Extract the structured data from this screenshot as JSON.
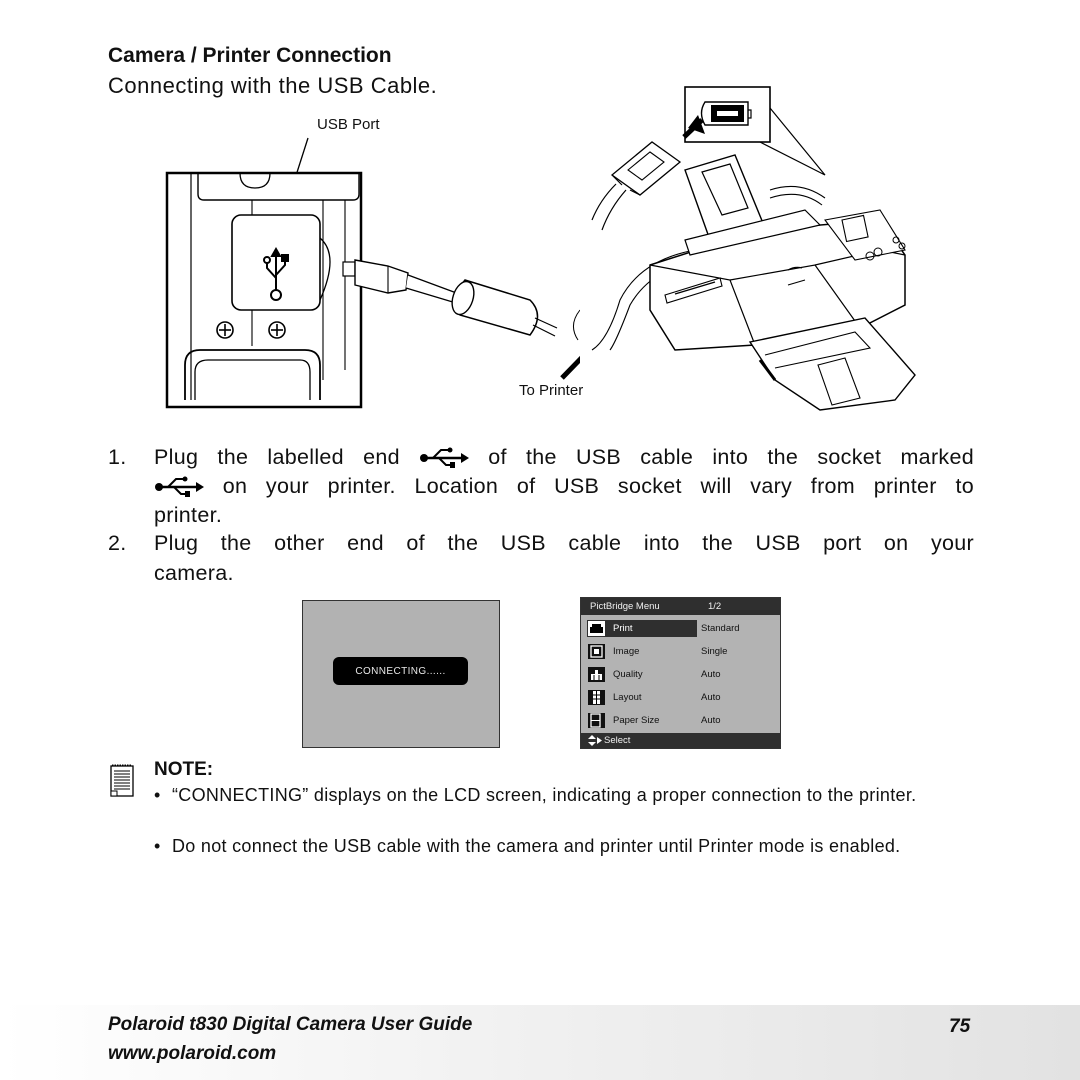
{
  "header": {
    "title": "Camera / Printer Connection",
    "subtitle": "Connecting with the USB Cable."
  },
  "illustration": {
    "label_usb_port": "USB Port",
    "label_to_printer": "To Printer"
  },
  "steps": [
    {
      "number": "1.",
      "lines": [
        {
          "before": "Plug the labelled end",
          "icon": "usb-icon",
          "after": "of the USB cable into the socket marked"
        },
        {
          "before": "",
          "icon": "usb-icon",
          "after": "on your printer. Location of USB socket will vary from printer to"
        },
        {
          "before": "printer.",
          "icon": null,
          "after": ""
        }
      ]
    },
    {
      "number": "2.",
      "lines": [
        {
          "before": "Plug the other end of the USB cable into the USB port on your",
          "icon": null,
          "after": ""
        },
        {
          "before": "camera.",
          "icon": null,
          "after": ""
        }
      ]
    }
  ],
  "lcd_connecting": {
    "message": "CONNECTING......"
  },
  "lcd_pictbridge": {
    "title": "PictBridge Menu",
    "page": "1/2",
    "selected_index": 0,
    "rows": [
      {
        "icon": "printer-icon",
        "name": "Print",
        "value": "Standard"
      },
      {
        "icon": "image-icon",
        "name": "Image",
        "value": "Single"
      },
      {
        "icon": "quality-icon",
        "name": "Quality",
        "value": "Auto"
      },
      {
        "icon": "layout-icon",
        "name": "Layout",
        "value": "Auto"
      },
      {
        "icon": "paper-size-icon",
        "name": "Paper Size",
        "value": "Auto"
      }
    ],
    "footer": "Select"
  },
  "note": {
    "title": "NOTE:",
    "items": [
      "“CONNECTING” displays on the LCD screen, indicating a proper connection to the printer.",
      "Do not connect the USB cable with the camera and printer until Printer mode is enabled."
    ]
  },
  "footer": {
    "guide_title": "Polaroid t830 Digital Camera User Guide",
    "website": "www.polaroid.com",
    "page_number": "75"
  }
}
